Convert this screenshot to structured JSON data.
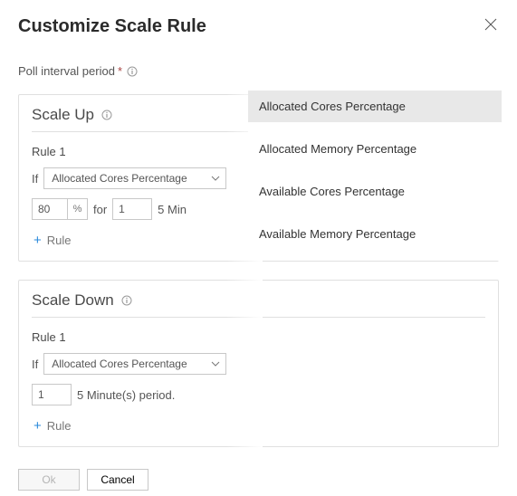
{
  "title": "Customize Scale Rule",
  "poll_label": "Poll interval period",
  "scale_up": {
    "heading": "Scale Up",
    "rule_title": "Rule 1",
    "if_label": "If",
    "dropdown_value": "Allocated Cores Percentage",
    "pct_value": "80",
    "for_label": "for",
    "duration_value": "1",
    "suffix_text": "5 Min",
    "add_rule_label": "Rule"
  },
  "scale_down": {
    "heading": "Scale Down",
    "rule_title": "Rule 1",
    "if_label": "If",
    "dropdown_value": "Allocated Cores Percentage",
    "duration_value": "1",
    "suffix_text": "5 Minute(s) period.",
    "add_rule_label": "Rule"
  },
  "footer": {
    "ok_label": "Ok",
    "cancel_label": "Cancel"
  },
  "popup": {
    "options": [
      "Allocated Cores Percentage",
      "Allocated Memory Percentage",
      "Available Cores Percentage",
      "Available Memory Percentage"
    ]
  }
}
